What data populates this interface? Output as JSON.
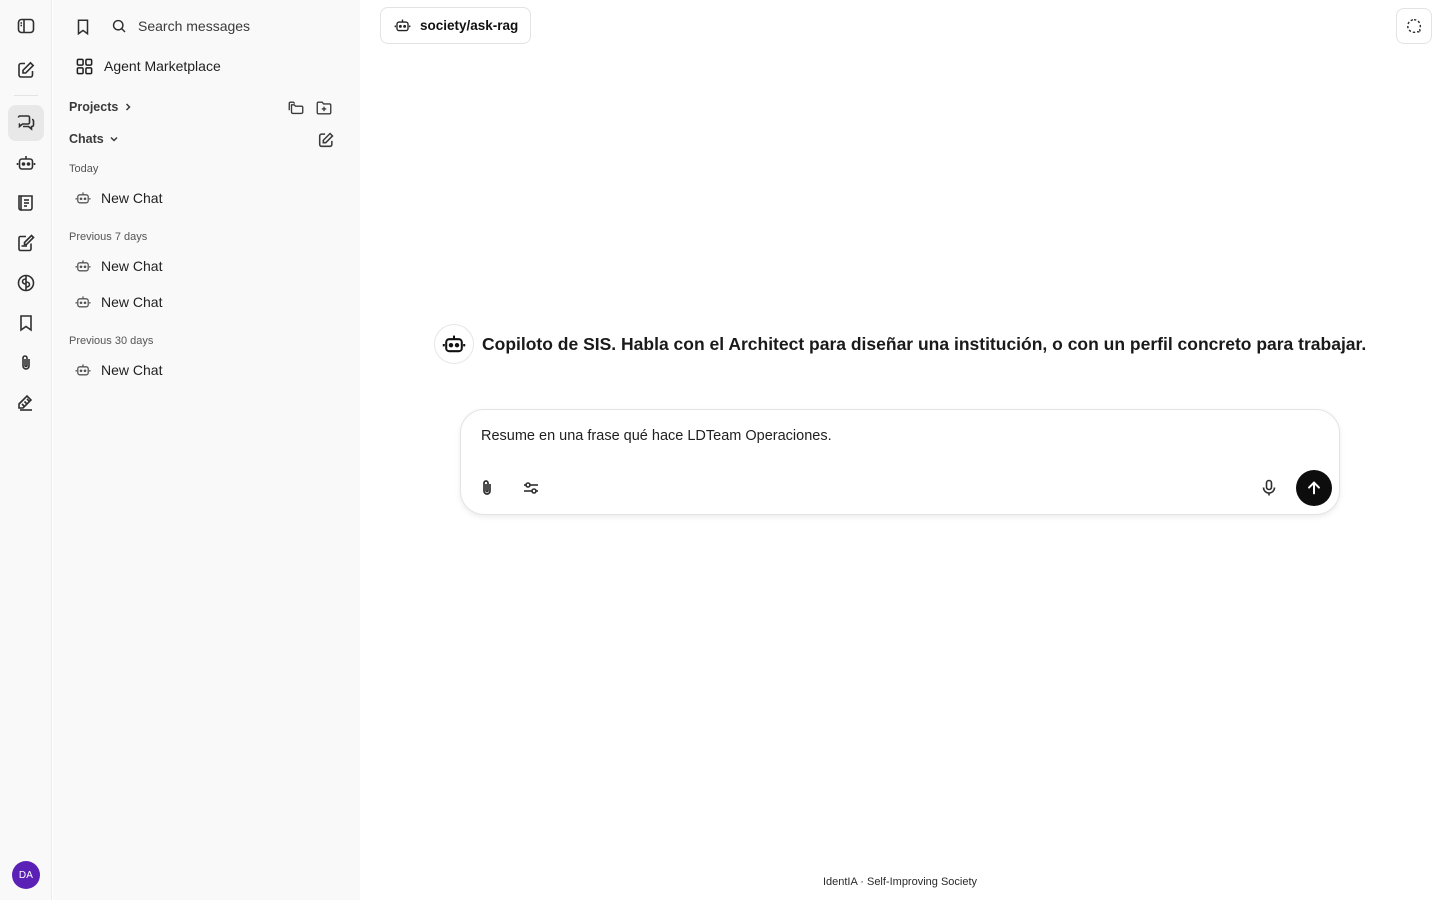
{
  "sidebar": {
    "search_placeholder": "Search messages",
    "marketplace_label": "Agent Marketplace",
    "projects_label": "Projects",
    "chats_label": "Chats",
    "groups": [
      {
        "label": "Today",
        "items": [
          {
            "label": "New Chat"
          }
        ]
      },
      {
        "label": "Previous 7 days",
        "items": [
          {
            "label": "New Chat"
          },
          {
            "label": "New Chat"
          }
        ]
      },
      {
        "label": "Previous 30 days",
        "items": [
          {
            "label": "New Chat"
          }
        ]
      }
    ]
  },
  "rail": {
    "icons": [
      "sidebar-toggle-icon",
      "new-chat-icon",
      "chats-icon",
      "agents-icon",
      "prompts-icon",
      "notes-icon",
      "memory-icon",
      "bookmarks-icon",
      "attachments-icon",
      "skills-icon"
    ],
    "avatar_initials": "DA",
    "avatar_color": "#5b21b6"
  },
  "header": {
    "agent_name": "society/ask-rag"
  },
  "main": {
    "intro_text": "Copiloto de SIS. Habla con el Architect para diseñar una institución, o con un perfil concreto para trabajar.",
    "composer_value": "Resume en una frase qué hace LDTeam Operaciones."
  },
  "footer": {
    "text": "IdentIA · Self-Improving Society"
  }
}
